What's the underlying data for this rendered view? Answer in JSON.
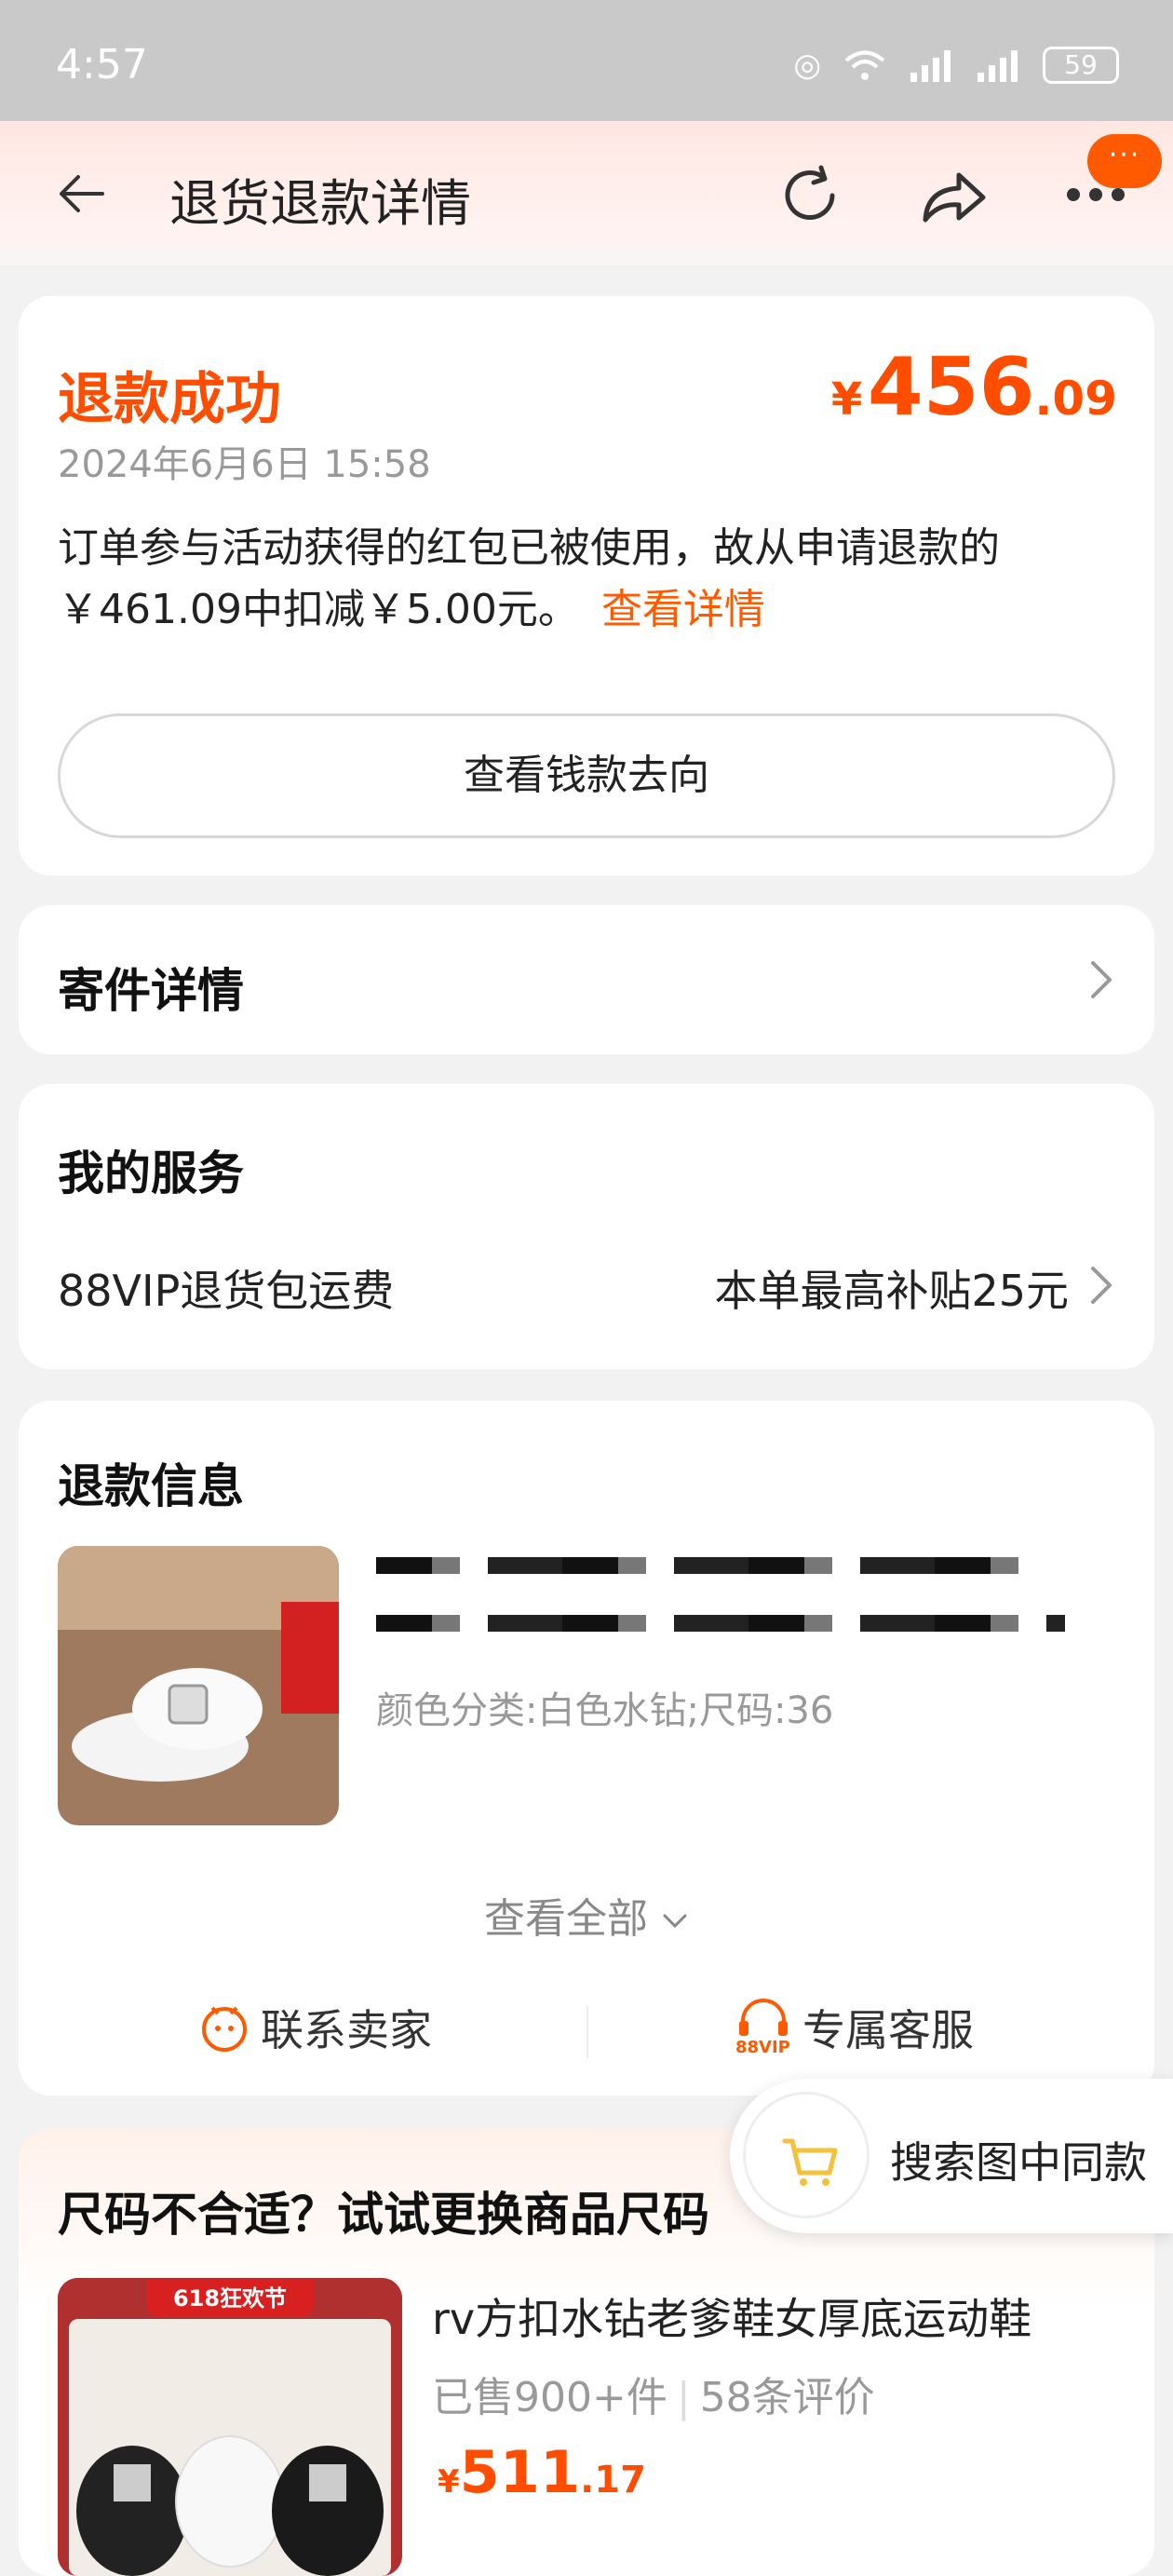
{
  "status_bar": {
    "time": "4:57",
    "battery": "59"
  },
  "header": {
    "title": "退货退款详情",
    "more_badge": "···"
  },
  "refund_summary": {
    "status": "退款成功",
    "amount_symbol": "¥",
    "amount_int": "456",
    "amount_dec": ".09",
    "datetime": "2024年6月6日 15:58",
    "notice": "订单参与活动获得的红包已被使用，故从申请退款的￥461.09中扣减￥5.00元。",
    "notice_link": "查看详情",
    "money_flow_button": "查看钱款去向"
  },
  "shipping": {
    "title": "寄件详情"
  },
  "services": {
    "title": "我的服务",
    "item_label": "88VIP退货包运费",
    "item_value": "本单最高补贴25元"
  },
  "refund_info": {
    "title": "退款信息",
    "spec": "颜色分类:白色水钻;尺码:36",
    "view_all": "查看全部",
    "contact_seller": "联系卖家",
    "exclusive_service": "专属客服",
    "vip_badge": "88VIP"
  },
  "floating_search": {
    "label": "搜索图中同款"
  },
  "recommendation": {
    "title": "尺码不合适？试试更换商品尺码",
    "product": {
      "badge": "618狂欢节",
      "name": "rv方扣水钻老爹鞋女厚底运动鞋",
      "sold": "已售900+件",
      "reviews": "58条评价",
      "price_symbol": "¥",
      "price_int": "511",
      "price_dec": ".17"
    }
  },
  "colors": {
    "accent": "#ff4d00",
    "status_bar": "#c9c9c9"
  }
}
